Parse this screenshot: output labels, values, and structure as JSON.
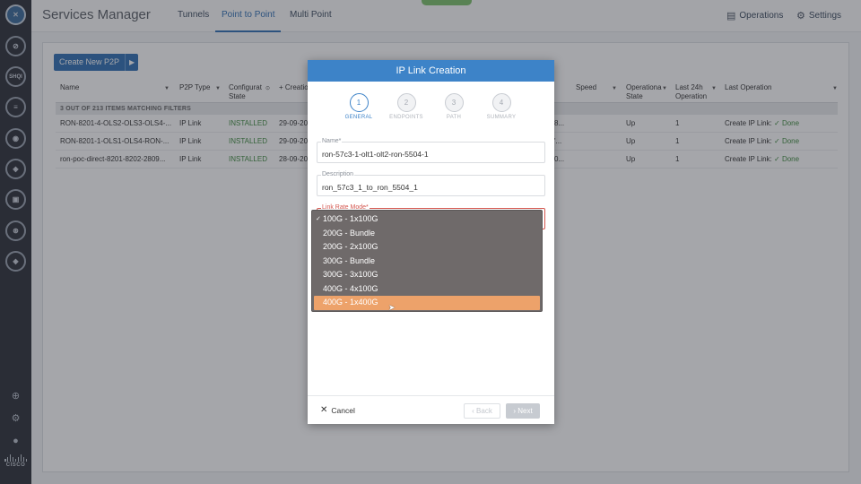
{
  "app": {
    "title": "Services Manager",
    "tabs": [
      {
        "label": "Tunnels",
        "active": false
      },
      {
        "label": "Point to Point",
        "active": true
      },
      {
        "label": "Multi Point",
        "active": false
      }
    ],
    "operations_label": "Operations",
    "settings_label": "Settings"
  },
  "sidebar": {
    "icons": [
      "brand-logo-icon",
      "topology-icon",
      "shqi-icon",
      "database-icon",
      "services-icon",
      "package-icon",
      "inventory-icon",
      "search-icon",
      "cube-icon"
    ],
    "shqi_label": "SHQI",
    "footer_icons": [
      "add-icon",
      "gear-icon",
      "user-icon"
    ],
    "brand": "CISCO"
  },
  "toolbar": {
    "create_label": "Create New P2P",
    "play_glyph": "▶"
  },
  "table": {
    "columns": {
      "name": "Name",
      "p2p_type": "P2P Type",
      "config_state": "Configurat State",
      "creation": "+ Creatio",
      "speed": "Speed",
      "operational_state": "Operationa State",
      "last24h": "Last 24h Operation",
      "last_operation": "Last Operation"
    },
    "filter_summary": "3 OUT OF 213 ITEMS MATCHING FILTERS",
    "rows": [
      {
        "name": "RON-8201-4-OLS2-OLS3-OLS4-...",
        "type": "IP Link",
        "state": "INSTALLED",
        "date": "29-09-20",
        "hidden": "8...",
        "op_state": "Up",
        "count": "1",
        "last_op": "Create IP Link:",
        "result": "✓ Done"
      },
      {
        "name": "RON-8201-1-OLS1-OLS4-RON-...",
        "type": "IP Link",
        "state": "INSTALLED",
        "date": "29-09-20",
        "hidden": "'...",
        "op_state": "Up",
        "count": "1",
        "last_op": "Create IP Link:",
        "result": "✓ Done"
      },
      {
        "name": "ron-poc-direct-8201-8202-2809...",
        "type": "IP Link",
        "state": "INSTALLED",
        "date": "28-09-20",
        "hidden": "0...",
        "op_state": "Up",
        "count": "1",
        "last_op": "Create IP Link:",
        "result": "✓ Done"
      }
    ]
  },
  "modal": {
    "title": "IP Link Creation",
    "steps": [
      {
        "num": "1",
        "label": "GENERAL",
        "active": true
      },
      {
        "num": "2",
        "label": "ENDPOINTS",
        "active": false
      },
      {
        "num": "3",
        "label": "PATH",
        "active": false
      },
      {
        "num": "4",
        "label": "SUMMARY",
        "active": false
      }
    ],
    "name_label": "Name*",
    "name_value": "ron-57c3-1-olt1-olt2-ron-5504-1",
    "description_label": "Description",
    "description_value": "ron_57c3_1_to_ron_5504_1",
    "link_rate_label": "Link Rate Mode*",
    "cancel_label": "Cancel",
    "back_label": "Back",
    "next_label": "Next"
  },
  "dropdown": {
    "options": [
      {
        "label": "100G - 1x100G",
        "selected": true,
        "highlighted": false
      },
      {
        "label": "200G - Bundle",
        "selected": false,
        "highlighted": false
      },
      {
        "label": "200G - 2x100G",
        "selected": false,
        "highlighted": false
      },
      {
        "label": "300G - Bundle",
        "selected": false,
        "highlighted": false
      },
      {
        "label": "300G - 3x100G",
        "selected": false,
        "highlighted": false
      },
      {
        "label": "400G - 4x100G",
        "selected": false,
        "highlighted": false
      },
      {
        "label": "400G - 1x400G",
        "selected": false,
        "highlighted": true
      }
    ],
    "checkmark": "✓"
  },
  "colors": {
    "accent": "#2f6fb3",
    "modal_header": "#3d83c8",
    "highlight": "#eda26a",
    "success": "#3e8a3e"
  }
}
